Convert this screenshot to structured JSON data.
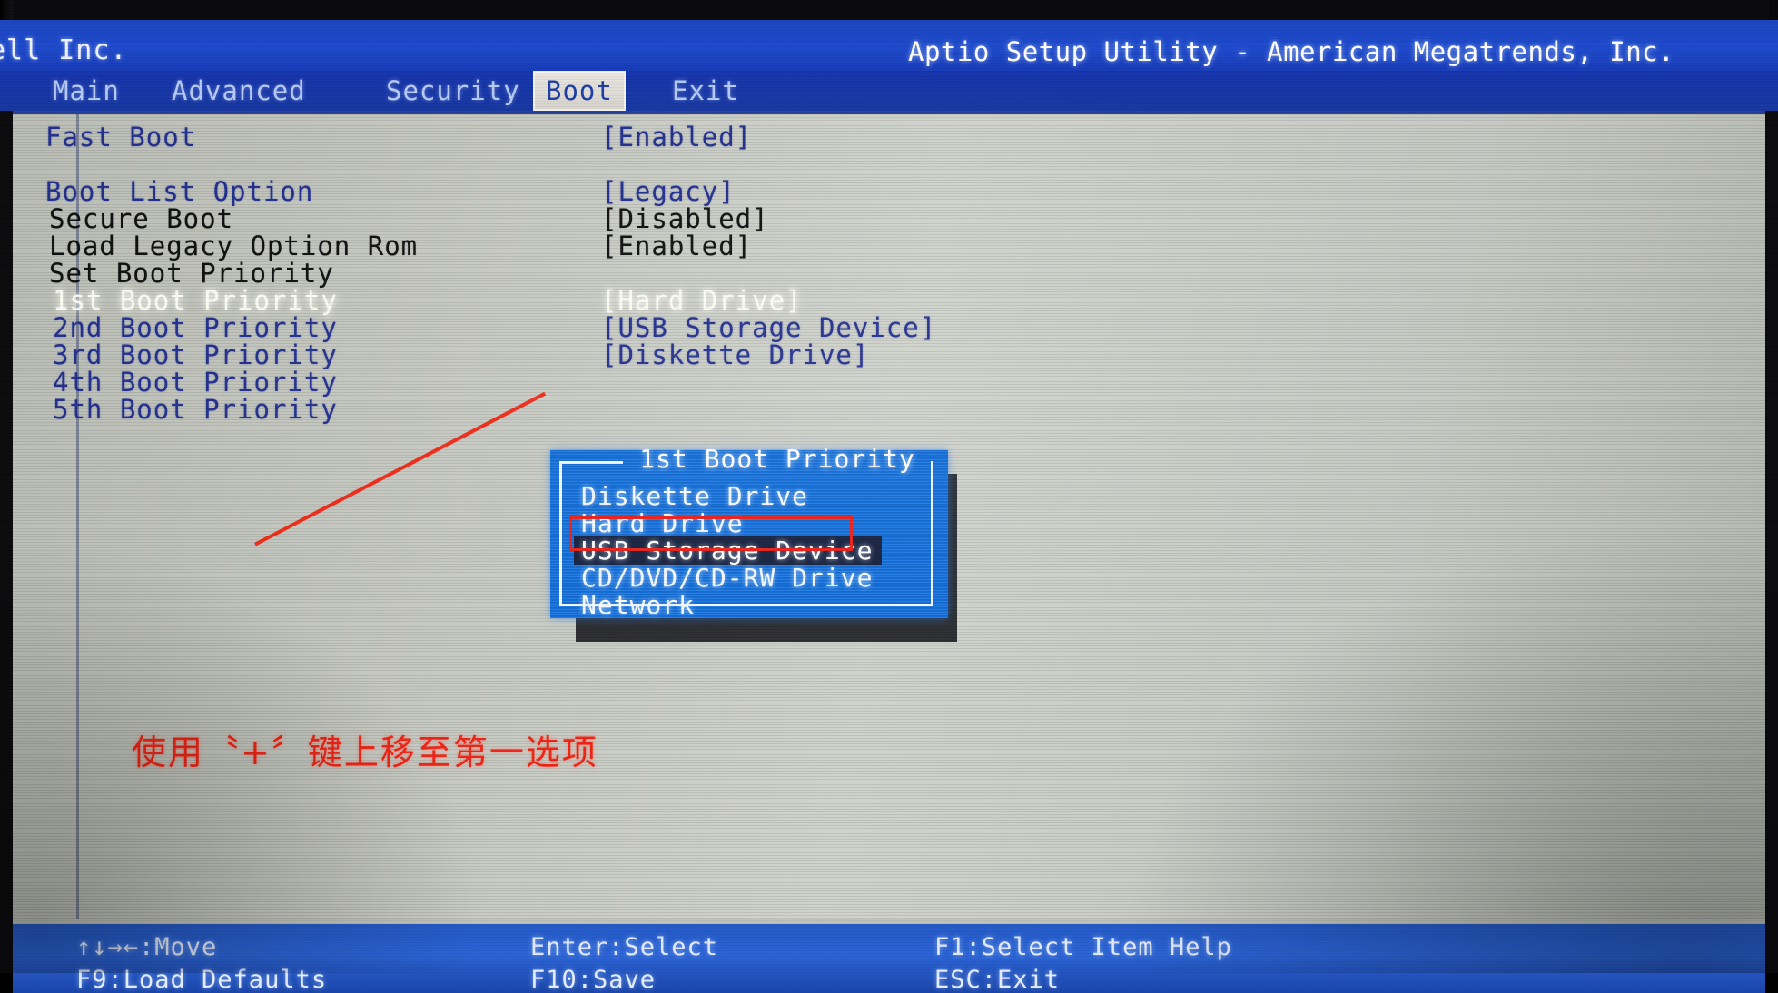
{
  "header": {
    "vendor": "ell Inc.",
    "utility_title": "Aptio Setup Utility - American Megatrends, Inc."
  },
  "tabs": [
    {
      "label": "Main",
      "active": false
    },
    {
      "label": "Advanced",
      "active": false
    },
    {
      "label": "Security",
      "active": false
    },
    {
      "label": "Boot",
      "active": true
    },
    {
      "label": "Exit",
      "active": false
    }
  ],
  "settings": [
    {
      "label": "Fast Boot",
      "value": "[Enabled]",
      "state": "normal"
    },
    {
      "label": "Boot List Option",
      "value": "[Legacy]",
      "state": "normal"
    },
    {
      "label": "Secure Boot",
      "value": "[Disabled]",
      "state": "dark"
    },
    {
      "label": "Load Legacy Option Rom",
      "value": "[Enabled]",
      "state": "dark"
    },
    {
      "label": "Set Boot Priority",
      "value": "",
      "state": "dark"
    },
    {
      "label": "1st Boot Priority",
      "value": "[Hard Drive]",
      "state": "selected"
    },
    {
      "label": "2nd Boot Priority",
      "value": "[USB Storage Device]",
      "state": "normal"
    },
    {
      "label": "3rd Boot Priority",
      "value": "[Diskette Drive]",
      "state": "normal"
    },
    {
      "label": "4th Boot Priority",
      "value": "",
      "state": "normal"
    },
    {
      "label": "5th Boot Priority",
      "value": "",
      "state": "normal"
    }
  ],
  "popup": {
    "title": "1st Boot Priority",
    "items": [
      {
        "label": "Diskette Drive",
        "selected": false
      },
      {
        "label": "Hard Drive",
        "selected": false
      },
      {
        "label": "USB Storage Device",
        "selected": true
      },
      {
        "label": "CD/DVD/CD-RW Drive",
        "selected": false
      },
      {
        "label": "Network",
        "selected": false
      }
    ]
  },
  "annotation": {
    "text": "使用〝+〞键上移至第一选项",
    "color": "#ef2417"
  },
  "footer": {
    "keys": [
      {
        "label": "↑↓→←:Move",
        "col": 0,
        "rowIdx": 0
      },
      {
        "label": "Enter:Select",
        "col": 1,
        "rowIdx": 0
      },
      {
        "label": "F1:Select Item Help",
        "col": 2,
        "rowIdx": 0
      },
      {
        "label": "F9:Load Defaults",
        "col": 0,
        "rowIdx": 1
      },
      {
        "label": "F10:Save",
        "col": 1,
        "rowIdx": 1
      },
      {
        "label": "ESC:Exit",
        "col": 2,
        "rowIdx": 1
      }
    ]
  },
  "colors": {
    "title_band": "#1d49cc",
    "body_gray": "#c6c9c2",
    "popup_blue": "#1070e0",
    "selected_bar": "#16213f",
    "annotation_red": "#ef2417",
    "label_navy": "#23308c"
  }
}
